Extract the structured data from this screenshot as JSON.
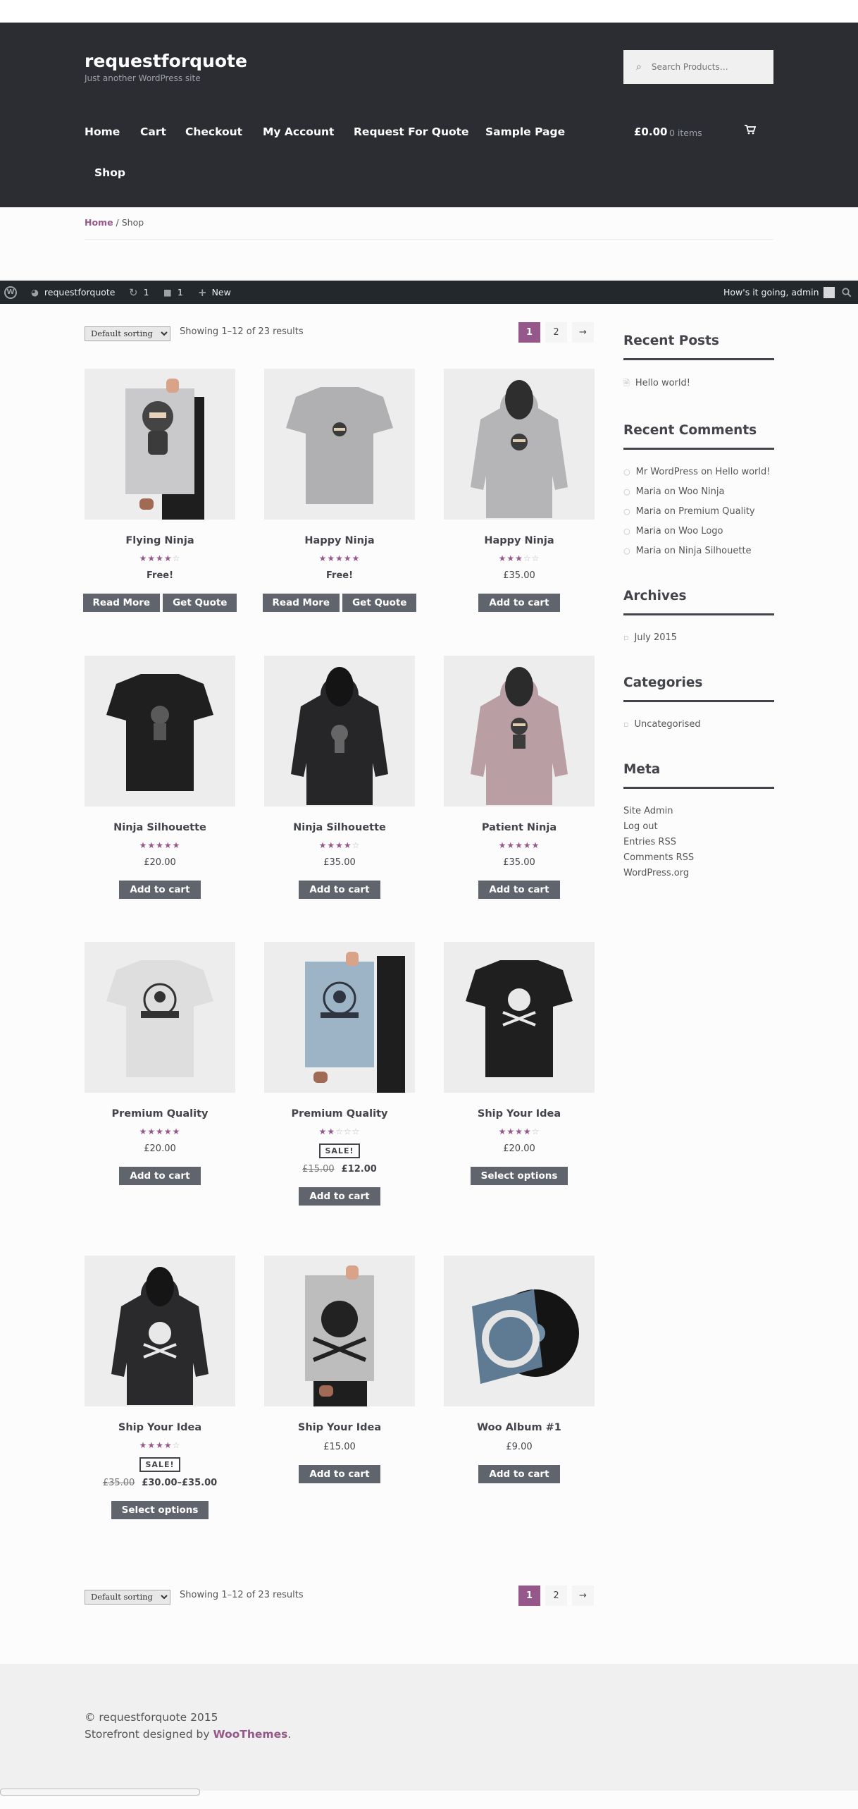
{
  "site": {
    "title": "requestforquote",
    "tagline": "Just another WordPress site"
  },
  "search": {
    "placeholder": "Search Products…"
  },
  "nav": [
    "Home",
    "Cart",
    "Checkout",
    "My Account",
    "Request For Quote",
    "Sample Page",
    "Shop"
  ],
  "cart": {
    "amount": "£0.00",
    "items": "0 items"
  },
  "breadcrumb": {
    "home": "Home",
    "current": "Shop"
  },
  "adminbar": {
    "site": "requestforquote",
    "updates": "1",
    "comments": "1",
    "new": "New",
    "greeting": "How's it going, admin"
  },
  "toolbar": {
    "sort": "Default sorting",
    "count": "Showing 1–12 of 23 results",
    "pages": [
      "1",
      "2",
      "→"
    ]
  },
  "products": [
    {
      "name": "Flying Ninja",
      "rating": 4,
      "price": "Free!",
      "buttons": [
        "Read More",
        "Get Quote"
      ]
    },
    {
      "name": "Happy Ninja",
      "rating": 4.5,
      "price": "Free!",
      "buttons": [
        "Read More",
        "Get Quote"
      ]
    },
    {
      "name": "Happy Ninja",
      "rating": 3,
      "price": "£35.00",
      "buttons": [
        "Add to cart"
      ]
    },
    {
      "name": "Ninja Silhouette",
      "rating": 5,
      "price": "£20.00",
      "buttons": [
        "Add to cart"
      ]
    },
    {
      "name": "Ninja Silhouette",
      "rating": 4,
      "price": "£35.00",
      "buttons": [
        "Add to cart"
      ]
    },
    {
      "name": "Patient Ninja",
      "rating": 4.5,
      "price": "£35.00",
      "buttons": [
        "Add to cart"
      ]
    },
    {
      "name": "Premium Quality",
      "rating": 4.5,
      "price": "£20.00",
      "buttons": [
        "Add to cart"
      ]
    },
    {
      "name": "Premium Quality",
      "rating": 2,
      "sale": "SALE!",
      "old_price": "£15.00",
      "price": "£12.00",
      "buttons": [
        "Add to cart"
      ]
    },
    {
      "name": "Ship Your Idea",
      "rating": 4,
      "price": "£20.00",
      "buttons": [
        "Select options"
      ]
    },
    {
      "name": "Ship Your Idea",
      "rating": 4,
      "sale": "SALE!",
      "old_price": "£35.00",
      "price": "£30.00–£35.00",
      "buttons": [
        "Select options"
      ]
    },
    {
      "name": "Ship Your Idea",
      "rating": 0,
      "price": "£15.00",
      "buttons": [
        "Add to cart"
      ]
    },
    {
      "name": "Woo Album #1",
      "rating": 0,
      "price": "£9.00",
      "buttons": [
        "Add to cart"
      ]
    }
  ],
  "sidebar": {
    "recent_posts": {
      "title": "Recent Posts",
      "items": [
        "Hello world!"
      ]
    },
    "recent_comments": {
      "title": "Recent Comments",
      "items": [
        "Mr WordPress on Hello world!",
        "Maria on Woo Ninja",
        "Maria on Premium Quality",
        "Maria on Woo Logo",
        "Maria on Ninja Silhouette"
      ]
    },
    "archives": {
      "title": "Archives",
      "items": [
        "July 2015"
      ]
    },
    "categories": {
      "title": "Categories",
      "items": [
        "Uncategorised"
      ]
    },
    "meta": {
      "title": "Meta",
      "items": [
        "Site Admin",
        "Log out",
        "Entries RSS",
        "Comments RSS",
        "WordPress.org"
      ]
    }
  },
  "footer": {
    "copyright": "© requestforquote 2015",
    "designed_by": "Storefront designed by",
    "designer": "WooThemes",
    "period": "."
  },
  "colors": {
    "accent": "#96588a",
    "header": "#2c2d33",
    "button": "#60646c",
    "adminbar": "#23282d"
  }
}
